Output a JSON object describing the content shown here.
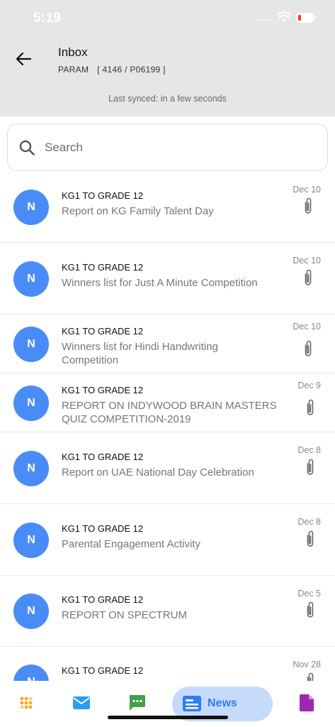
{
  "status_bar": {
    "time": "5:19",
    "signal": "•••••"
  },
  "header": {
    "title": "Inbox",
    "student_name": "PARAM",
    "student_code": "[ 4146 / P06199 ]",
    "sync_status": "Last synced: in a few seconds"
  },
  "search": {
    "placeholder": "Search",
    "value": ""
  },
  "messages": [
    {
      "avatar": "N",
      "sender": "KG1 TO GRADE 12",
      "subject": "Report on KG Family Talent Day",
      "date": "Dec 10",
      "has_attachment": true
    },
    {
      "avatar": "N",
      "sender": "KG1 TO GRADE 12",
      "subject": "Winners list for Just A Minute Competition",
      "date": "Dec 10",
      "has_attachment": true
    },
    {
      "avatar": "N",
      "sender": "KG1 TO GRADE 12",
      "subject": "Winners list for Hindi Handwriting Competition",
      "date": "Dec 10",
      "has_attachment": true
    },
    {
      "avatar": "N",
      "sender": "KG1 TO GRADE 12",
      "subject": "REPORT ON INDYWOOD BRAIN MASTERS QUIZ COMPETITION-2019",
      "date": "Dec 9",
      "has_attachment": true
    },
    {
      "avatar": "N",
      "sender": "KG1 TO GRADE 12",
      "subject": "Report on UAE National Day Celebration",
      "date": "Dec 8",
      "has_attachment": true
    },
    {
      "avatar": "N",
      "sender": "KG1 TO GRADE 12",
      "subject": "Parental Engagement Activity",
      "date": "Dec 8",
      "has_attachment": true
    },
    {
      "avatar": "N",
      "sender": "KG1 TO GRADE 12",
      "subject": "REPORT ON SPECTRUM",
      "date": "Dec 5",
      "has_attachment": true
    },
    {
      "avatar": "N",
      "sender": "KG1 TO GRADE 12",
      "subject": "",
      "date": "Nov 28",
      "has_attachment": true
    }
  ],
  "bottom_nav": {
    "items": [
      {
        "icon": "dots-grid-icon",
        "color": "#f5a623"
      },
      {
        "icon": "mail-icon",
        "color": "#2a9df4"
      },
      {
        "icon": "chat-icon",
        "color": "#43a047"
      },
      {
        "icon": "news-icon",
        "color": "#2f7df6",
        "label": "News",
        "active": true
      },
      {
        "icon": "document-icon",
        "color": "#9c27b0"
      }
    ]
  },
  "colors": {
    "header_bg": "#e6e6e6",
    "avatar_bg": "#4a8cf7",
    "accent": "#2f7df6",
    "news_pill": "#c6dafb"
  }
}
